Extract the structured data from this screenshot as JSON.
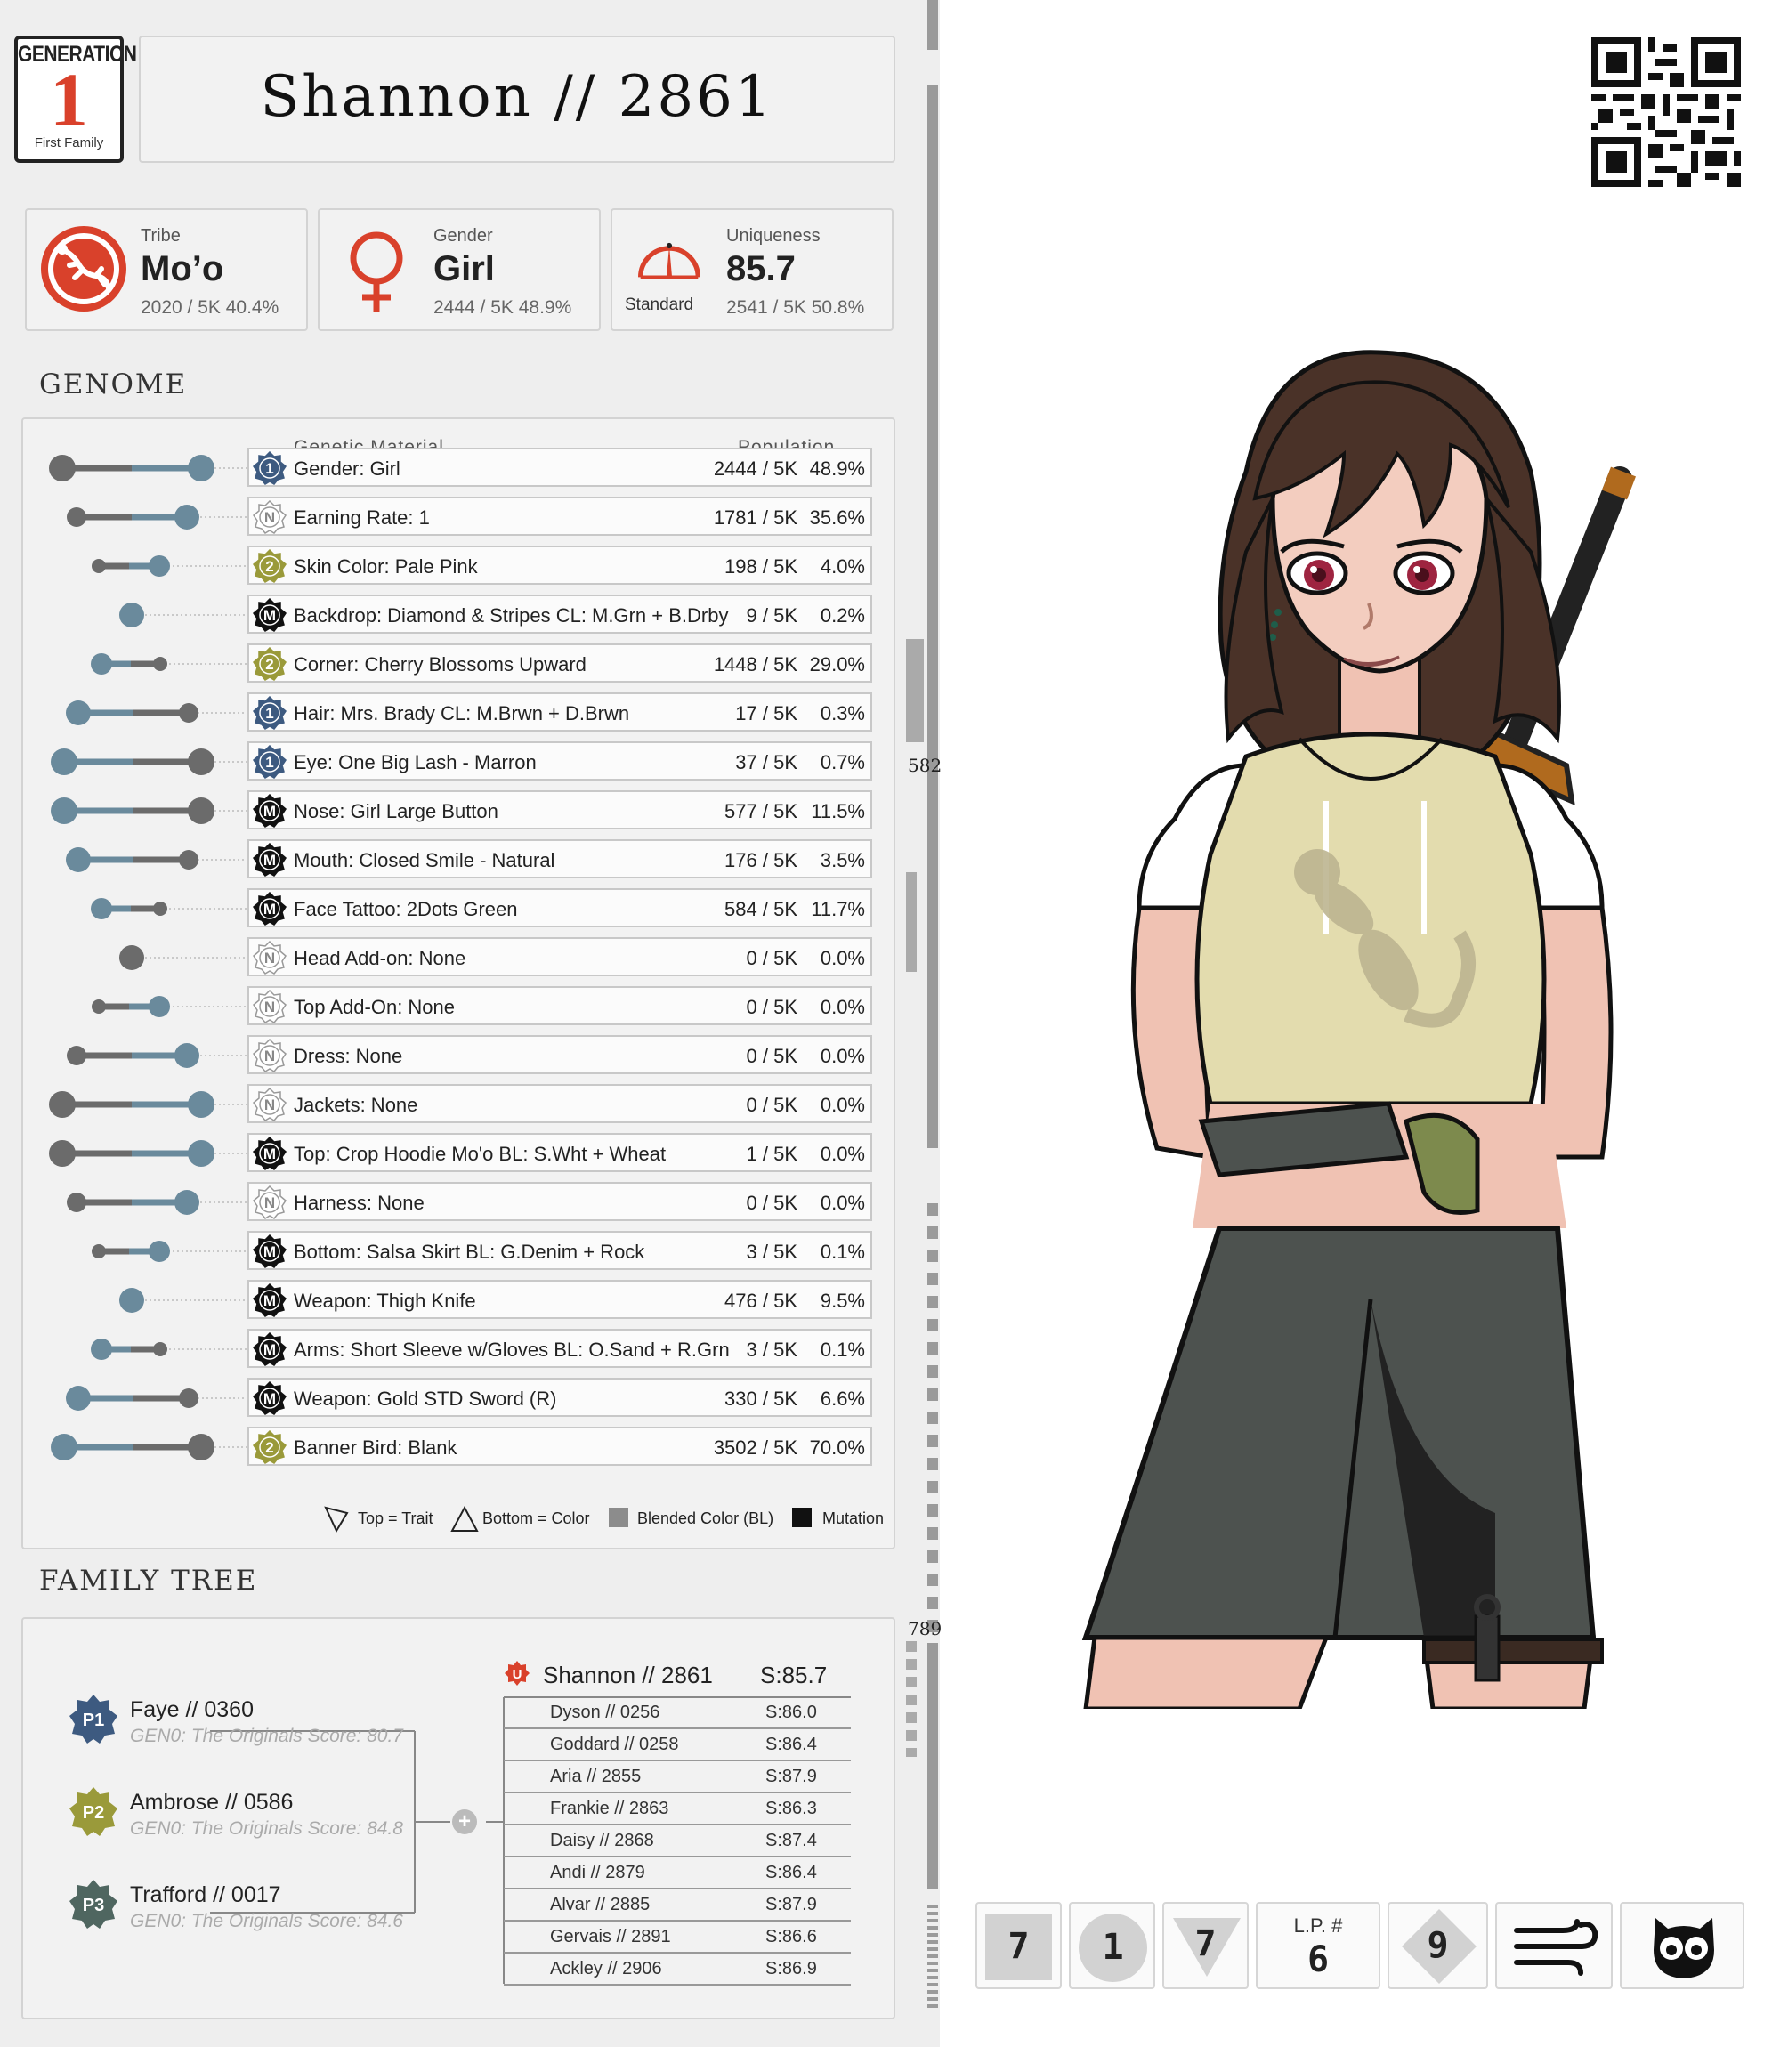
{
  "header": {
    "generation_top": "GENERATION",
    "generation_number": "1",
    "generation_sub": "First Family",
    "title": "Shannon // 2861"
  },
  "stats": {
    "tribe": {
      "label": "Tribe",
      "value": "Mo’o",
      "pop": "2020 / 5K  40.4%",
      "icon": "gecko-tribe-icon"
    },
    "gender": {
      "label": "Gender",
      "value": "Girl",
      "pop": "2444 / 5K  48.9%",
      "icon": "female-symbol-icon"
    },
    "uniqueness": {
      "label": "Uniqueness",
      "value": "85.7",
      "pop": "2541 / 5K  50.8%",
      "gauge_label": "Standard",
      "icon": "gauge-icon"
    }
  },
  "genome": {
    "section_title": "GENOME",
    "col_material": "Genetic Material",
    "col_population": "Population",
    "genes": [
      {
        "name": "Gender: Girl",
        "count": "2444 / 5K",
        "pct": "48.9%",
        "badge": "1",
        "badge_color": "#3d5a80"
      },
      {
        "name": "Earning Rate: 1",
        "count": "1781 / 5K",
        "pct": "35.6%",
        "badge": "N",
        "badge_color": "#ffffff"
      },
      {
        "name": "Skin Color: Pale Pink",
        "count": "198 / 5K",
        "pct": "4.0%",
        "badge": "2",
        "badge_color": "#9a9a3a"
      },
      {
        "name": "Backdrop: Diamond & Stripes CL: M.Grn + B.Drby",
        "count": "9 / 5K",
        "pct": "0.2%",
        "badge": "M",
        "badge_color": "#111111"
      },
      {
        "name": "Corner: Cherry Blossoms Upward",
        "count": "1448 / 5K",
        "pct": "29.0%",
        "badge": "2",
        "badge_color": "#9a9a3a"
      },
      {
        "name": "Hair: Mrs. Brady CL: M.Brwn + D.Brwn",
        "count": "17 / 5K",
        "pct": "0.3%",
        "badge": "1",
        "badge_color": "#3d5a80"
      },
      {
        "name": "Eye: One Big Lash - Marron",
        "count": "37 / 5K",
        "pct": "0.7%",
        "badge": "1",
        "badge_color": "#3d5a80"
      },
      {
        "name": "Nose: Girl Large Button",
        "count": "577 / 5K",
        "pct": "11.5%",
        "badge": "M",
        "badge_color": "#111111"
      },
      {
        "name": "Mouth: Closed Smile - Natural",
        "count": "176 / 5K",
        "pct": "3.5%",
        "badge": "M",
        "badge_color": "#111111"
      },
      {
        "name": "Face Tattoo: 2Dots Green",
        "count": "584 / 5K",
        "pct": "11.7%",
        "badge": "M",
        "badge_color": "#111111"
      },
      {
        "name": "Head Add-on:  None",
        "count": "0 / 5K",
        "pct": "0.0%",
        "badge": "N",
        "badge_color": "#ffffff"
      },
      {
        "name": "Top Add-On: None",
        "count": "0 / 5K",
        "pct": "0.0%",
        "badge": "N",
        "badge_color": "#ffffff"
      },
      {
        "name": "Dress: None",
        "count": "0 / 5K",
        "pct": "0.0%",
        "badge": "N",
        "badge_color": "#ffffff"
      },
      {
        "name": "Jackets: None",
        "count": "0 / 5K",
        "pct": "0.0%",
        "badge": "N",
        "badge_color": "#ffffff"
      },
      {
        "name": "Top: Crop Hoodie Mo'o BL: S.Wht + Wheat",
        "count": "1 / 5K",
        "pct": "0.0%",
        "badge": "M",
        "badge_color": "#111111"
      },
      {
        "name": "Harness: None",
        "count": "0 / 5K",
        "pct": "0.0%",
        "badge": "N",
        "badge_color": "#ffffff"
      },
      {
        "name": "Bottom: Salsa Skirt BL: G.Denim + Rock",
        "count": "3 / 5K",
        "pct": "0.1%",
        "badge": "M",
        "badge_color": "#111111"
      },
      {
        "name": "Weapon: Thigh Knife",
        "count": "476 / 5K",
        "pct": "9.5%",
        "badge": "M",
        "badge_color": "#111111"
      },
      {
        "name": "Arms: Short Sleeve w/Gloves BL: O.Sand + R.Grn",
        "count": "3 / 5K",
        "pct": "0.1%",
        "badge": "M",
        "badge_color": "#111111"
      },
      {
        "name": "Weapon: Gold STD Sword (R)",
        "count": "330 / 5K",
        "pct": "6.6%",
        "badge": "M",
        "badge_color": "#111111"
      },
      {
        "name": "Banner Bird:  Blank",
        "count": "3502 / 5K",
        "pct": "70.0%",
        "badge": "2",
        "badge_color": "#9a9a3a"
      }
    ],
    "legend": {
      "trait": "Top = Trait",
      "color": "Bottom = Color",
      "blended": "Blended Color (BL)",
      "mutation": "Mutation"
    }
  },
  "family_tree": {
    "section_title": "FAMILY TREE",
    "parents": [
      {
        "badge": "P1",
        "name": "Faye  //  0360",
        "sub": "GEN0: The Originals Score: 80.7",
        "color": "#3d5a80"
      },
      {
        "badge": "P2",
        "name": "Ambrose  //  0586",
        "sub": "GEN0: The Originals Score: 84.8",
        "color": "#9a9a3a"
      },
      {
        "badge": "P3",
        "name": "Trafford  //  0017",
        "sub": "GEN0: The Originals Score: 84.6",
        "color": "#4f6660"
      }
    ],
    "self": {
      "badge": "U",
      "name": "Shannon // 2861",
      "score": "S:85.7"
    },
    "siblings": [
      {
        "name": "Dyson  //  0256",
        "score": "S:86.0"
      },
      {
        "name": "Goddard  //  0258",
        "score": "S:86.4"
      },
      {
        "name": "Aria  //  2855",
        "score": "S:87.9"
      },
      {
        "name": "Frankie  //  2863",
        "score": "S:86.3"
      },
      {
        "name": "Daisy  //  2868",
        "score": "S:87.4"
      },
      {
        "name": "Andi  //  2879",
        "score": "S:86.4"
      },
      {
        "name": "Alvar  //  2885",
        "score": "S:87.9"
      },
      {
        "name": "Gervais  //  2891",
        "score": "S:86.6"
      },
      {
        "name": "Ackley  //  2906",
        "score": "S:86.9"
      }
    ]
  },
  "barcode_labels": {
    "top": "582",
    "bottom": "789"
  },
  "bottom_stats": {
    "square": "7",
    "circle": "1",
    "triangle": "7",
    "lp_label": "L.P. #",
    "lp_value": "6",
    "diamond": "9",
    "wind_icon": "wind-icon",
    "owl_icon": "owl-icon"
  },
  "colors": {
    "accent_red": "#d9412b",
    "trait_blue": "#6a8a9c",
    "trait_gray": "#6b6b6b"
  }
}
